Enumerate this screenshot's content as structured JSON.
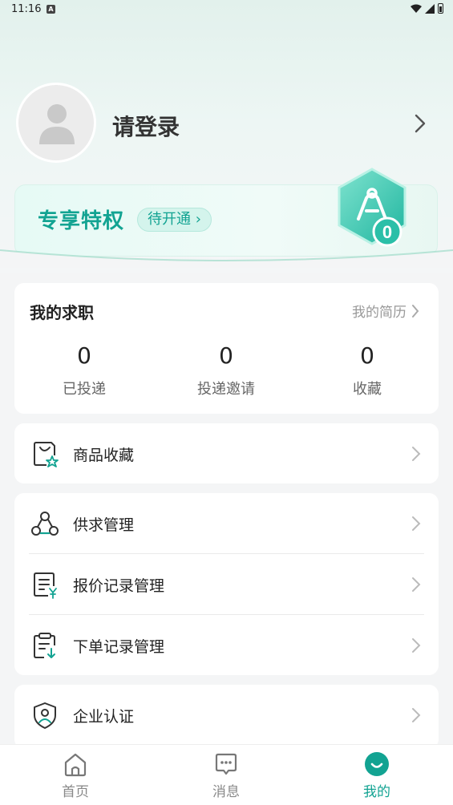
{
  "status_bar": {
    "time": "11:16",
    "notif_letter": "A"
  },
  "profile": {
    "login_text": "请登录"
  },
  "vip": {
    "title": "专享特权",
    "pill_label": "待开通",
    "badge_count": "0"
  },
  "job": {
    "title": "我的求职",
    "resume_link": "我的简历",
    "stats": [
      {
        "value": "0",
        "label": "已投递"
      },
      {
        "value": "0",
        "label": "投递邀请"
      },
      {
        "value": "0",
        "label": "收藏"
      }
    ]
  },
  "menu": {
    "favorites": "商品收藏",
    "supply": "供求管理",
    "quote": "报价记录管理",
    "order": "下单记录管理",
    "enterprise": "企业认证"
  },
  "tabs": [
    {
      "label": "首页"
    },
    {
      "label": "消息"
    },
    {
      "label": "我的"
    }
  ],
  "colors": {
    "accent": "#12a392",
    "background": "#f4f5f6"
  }
}
